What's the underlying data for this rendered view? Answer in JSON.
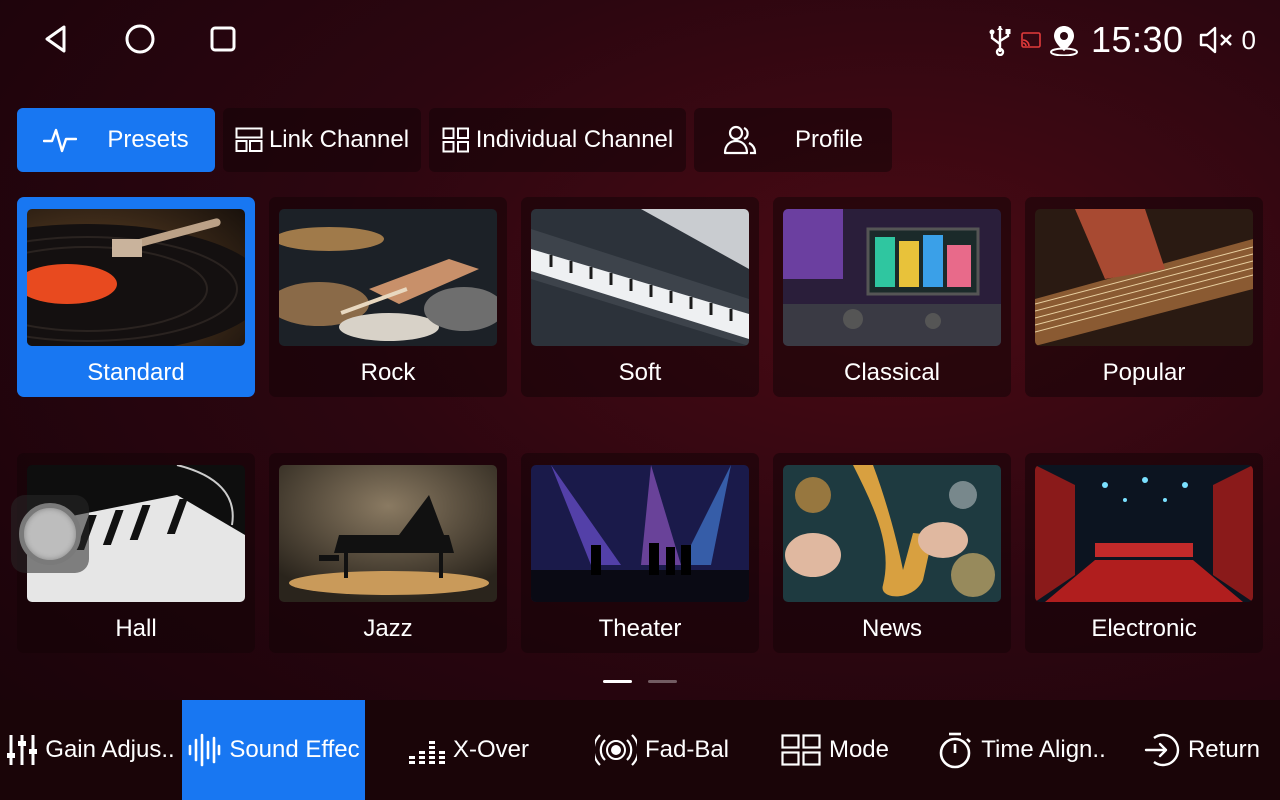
{
  "status": {
    "time": "15:30",
    "volume": "0",
    "icons": [
      "usb-icon",
      "cast-icon",
      "location-icon",
      "volume-mute-icon"
    ]
  },
  "nav": {
    "icons": [
      "back-icon",
      "home-icon",
      "recents-icon"
    ]
  },
  "tabs": [
    {
      "label": "Presets",
      "icon": "pulse-icon",
      "active": true
    },
    {
      "label": "Link Channel",
      "icon": "link-grid-icon",
      "active": false
    },
    {
      "label": "Individual Channel",
      "icon": "grid-icon",
      "active": false
    },
    {
      "label": "Profile",
      "icon": "users-icon",
      "active": false
    }
  ],
  "presets": [
    {
      "label": "Standard",
      "selected": true
    },
    {
      "label": "Rock",
      "selected": false
    },
    {
      "label": "Soft",
      "selected": false
    },
    {
      "label": "Classical",
      "selected": false
    },
    {
      "label": "Popular",
      "selected": false
    },
    {
      "label": "Hall",
      "selected": false
    },
    {
      "label": "Jazz",
      "selected": false
    },
    {
      "label": "Theater",
      "selected": false
    },
    {
      "label": "News",
      "selected": false
    },
    {
      "label": "Electronic",
      "selected": false
    }
  ],
  "pager": {
    "current": 1,
    "total": 2
  },
  "bottom_nav": [
    {
      "label": "Gain Adjus..",
      "icon": "sliders-icon",
      "active": false
    },
    {
      "label": "Sound Effec",
      "icon": "waveform-icon",
      "active": true
    },
    {
      "label": "X-Over",
      "icon": "equalizer-icon",
      "active": false
    },
    {
      "label": "Fad-Bal",
      "icon": "speaker-radiate-icon",
      "active": false
    },
    {
      "label": "Mode",
      "icon": "mode-icon",
      "active": false
    },
    {
      "label": "Time Align..",
      "icon": "timer-icon",
      "active": false
    },
    {
      "label": "Return",
      "icon": "return-icon",
      "active": false
    }
  ],
  "colors": {
    "accent": "#1877f2",
    "background": "#2c0610",
    "bar": "#1a0508"
  }
}
